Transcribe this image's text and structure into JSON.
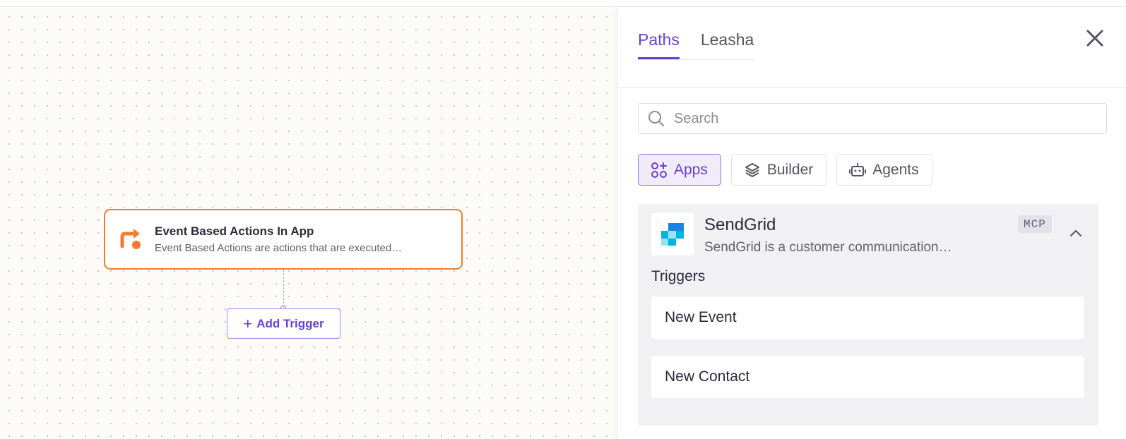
{
  "canvas": {
    "node": {
      "title": "Event Based Actions In App",
      "description": "Event Based Actions are actions that are executed…",
      "icon": "redirect-arrow-icon",
      "accent_color": "#f47c2c"
    },
    "add_trigger_label": "Add Trigger"
  },
  "panel": {
    "tabs": [
      {
        "label": "Paths",
        "active": true
      },
      {
        "label": "Leasha",
        "active": false
      }
    ],
    "search": {
      "placeholder": "Search",
      "value": ""
    },
    "filters": [
      {
        "label": "Apps",
        "icon": "apps-icon",
        "active": true
      },
      {
        "label": "Builder",
        "icon": "builder-icon",
        "active": false
      },
      {
        "label": "Agents",
        "icon": "robot-icon",
        "active": false
      }
    ],
    "app": {
      "name": "SendGrid",
      "description": "SendGrid is a customer communication…",
      "badge": "MCP",
      "section_title": "Triggers",
      "triggers": [
        "New Event",
        "New Contact"
      ]
    },
    "accent_color": "#6b3fd3"
  }
}
